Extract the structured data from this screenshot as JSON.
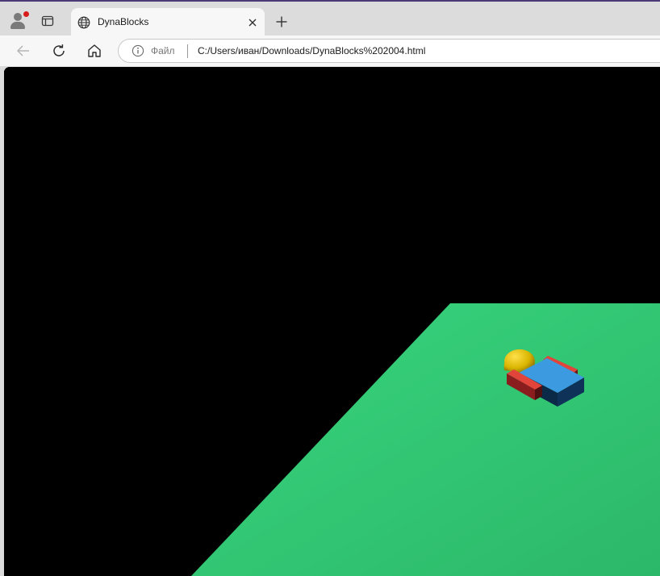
{
  "tab": {
    "title": "DynaBlocks",
    "icon": "globe-icon"
  },
  "address": {
    "scheme_label": "Файл",
    "url": "C:/Users/иван/Downloads/DynaBlocks%202004.html"
  },
  "scene": {
    "background_color": "#000000",
    "ground_color": "#33cc77",
    "ball_color": "#d9b400",
    "block_top_color": "#3b9ae0",
    "block_side_color": "#0b2a48",
    "red_color": "#e0443a",
    "dark_red_color": "#6a1818"
  }
}
